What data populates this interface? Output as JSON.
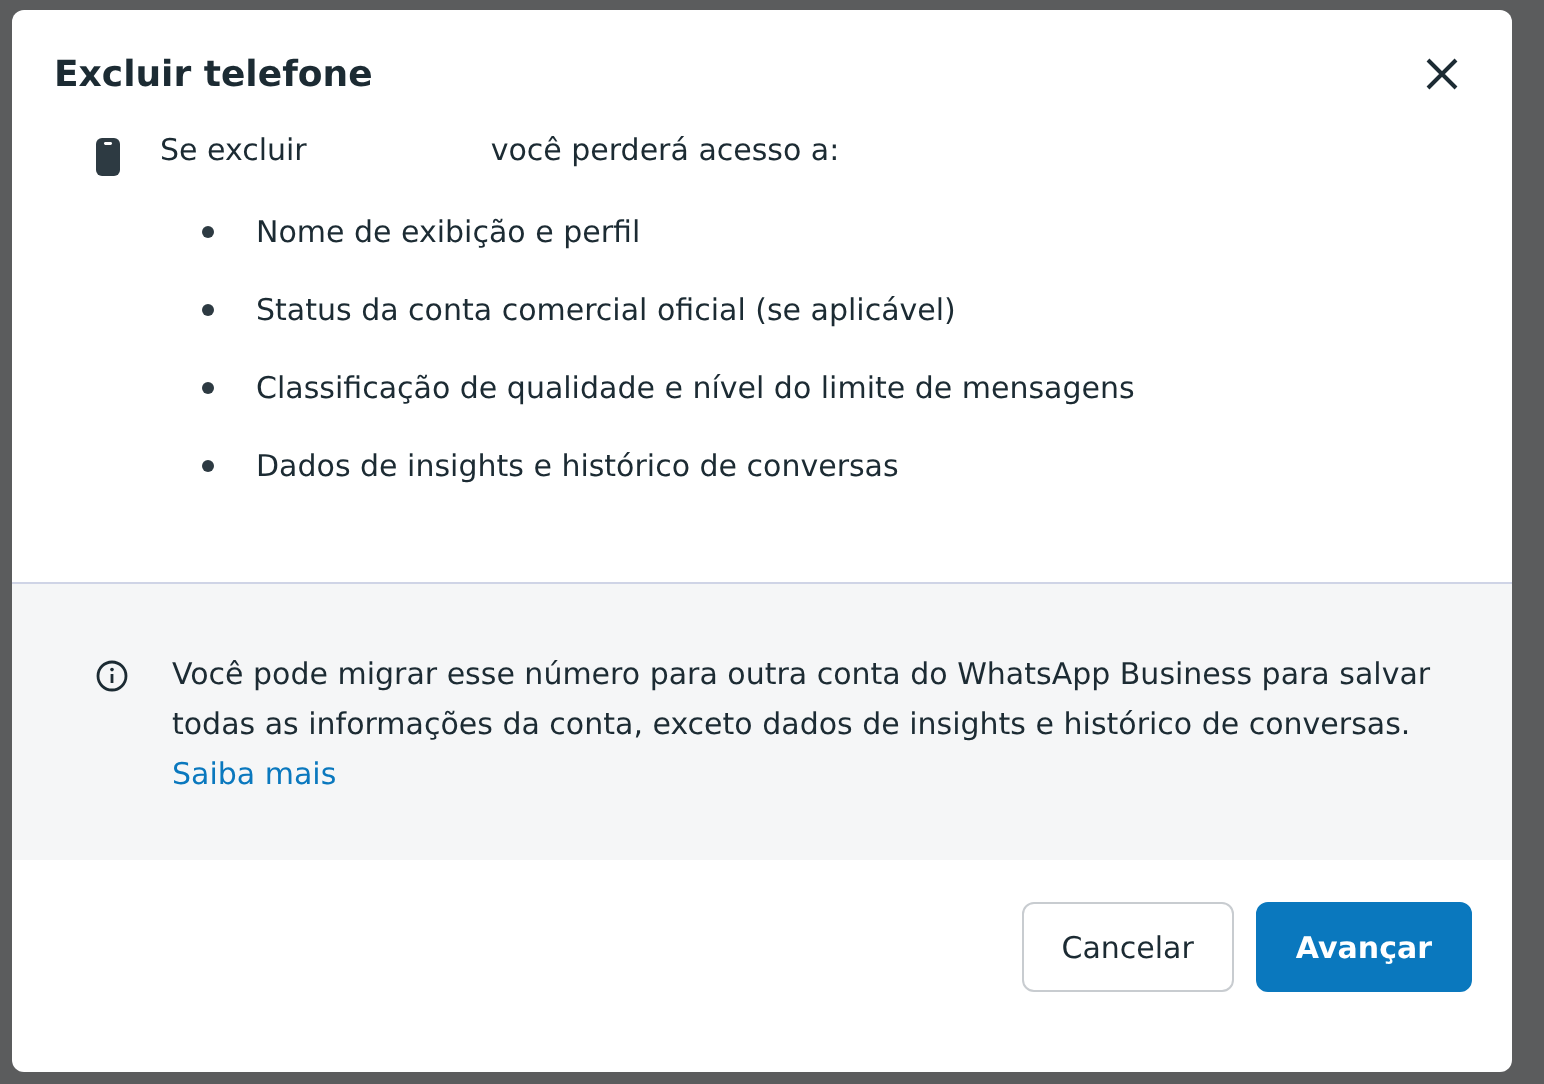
{
  "dialog": {
    "title": "Excluir telefone",
    "intro": {
      "before": "Se excluir",
      "after": "você perderá acesso a:"
    },
    "items": [
      "Nome de exibição e perfil",
      "Status da conta comercial oficial (se aplicável)",
      "Classificação de qualidade e nível do limite de mensagens",
      "Dados de insights e histórico de conversas"
    ],
    "notice": {
      "text": "Você pode migrar esse número para outra conta do WhatsApp Business para salvar todas as informações da conta, exceto dados de insights e histórico de conversas.",
      "link": "Saiba mais"
    },
    "buttons": [
      {
        "label": "Cancelar",
        "kind": "secondary"
      },
      {
        "label": "Avançar",
        "kind": "primary"
      }
    ]
  }
}
